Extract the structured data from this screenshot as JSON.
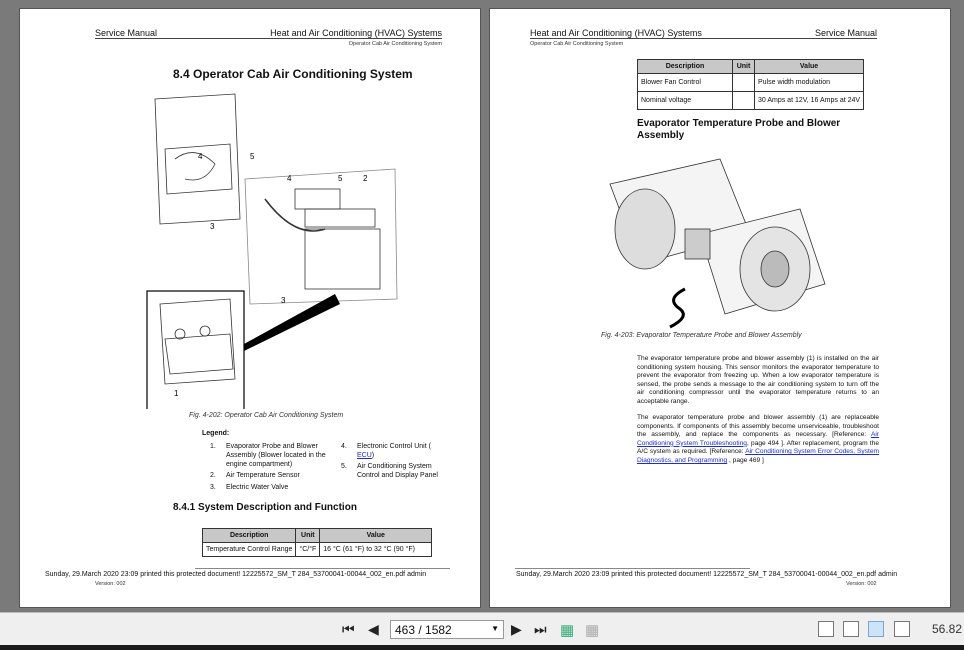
{
  "left_page": {
    "header_left": "Service Manual",
    "header_right": "Heat and Air Conditioning (HVAC) Systems",
    "header_sub": "Operator Cab Air Conditioning System",
    "title": "8.4  Operator Cab Air Conditioning System",
    "figure_callouts": [
      "4",
      "5",
      "3",
      "4",
      "5",
      "2",
      "3",
      "1"
    ],
    "figure_caption": "Fig.  4-202: Operator Cab Air Conditioning System",
    "legend_title": "Legend:",
    "legend": [
      {
        "n": "1.",
        "text": "Evaporator Probe and Blower Assembly (Blower located in the engine compartment)"
      },
      {
        "n": "2.",
        "text": "Air Temperature Sensor"
      },
      {
        "n": "3.",
        "text": "Electric Water Valve"
      },
      {
        "n": "4.",
        "text": "Electronic Control Unit (",
        "link": "ECU",
        "after": ")"
      },
      {
        "n": "5.",
        "text": "Air Conditioning System Control and Display Panel"
      }
    ],
    "section": "8.4.1  System Description and Function",
    "table": {
      "headers": [
        "Description",
        "Unit",
        "Value"
      ],
      "rows": [
        [
          "Temperature Control Range",
          "°C/°F",
          "16 °C (61 °F) to 32 °C (90 °F)"
        ]
      ]
    },
    "footer": "Sunday, 29.March 2020 23:09 printed this protected document! 12225572_SM_T 284_53700041-00044_002_en.pdf admin",
    "version": "Version: 002"
  },
  "right_page": {
    "header_left": "Heat and Air Conditioning (HVAC) Systems",
    "header_right": "Service Manual",
    "header_sub": "Operator Cab Air Conditioning System",
    "table": {
      "headers": [
        "Description",
        "Unit",
        "Value"
      ],
      "rows": [
        [
          "Blower Fan Control",
          "",
          "Pulse width modulation"
        ],
        [
          "Nominal voltage",
          "",
          "30 Amps at 12V, 16 Amps at 24V"
        ]
      ]
    },
    "heading": "Evaporator Temperature Probe and Blower Assembly",
    "figure_caption": "Fig.  4-203: Evaporator Temperature Probe and Blower Assembly",
    "para1": "The evaporator temperature probe and blower assembly (1) is installed on the air conditioning system housing. This sensor monitors the evaporator temperature to prevent the evaporator from freezing up. When a low evaporator temperature is sensed, the probe sends a message to the air conditioning system to turn off the air conditioning compressor until the evaporator temperature returns to an acceptable range.",
    "para2_a": "The evaporator temperature probe and blower assembly (1) are replaceable components. If components of this assembly become unserviceable, troubleshoot the assembly, and replace the components as necessary. [Reference: ",
    "para2_link1": "Air Conditioning System Troubleshooting",
    "para2_b": ", page   494 ]. After replacement, program the A/C system as required. [Reference: ",
    "para2_link2": "Air Conditioning System Error Codes, System Diagnostics, and Programming",
    "para2_c": " , page   469 ]",
    "footer": "Sunday, 29.March 2020 23:09 printed this protected document! 12225572_SM_T 284_53700041-00044_002_en.pdf admin",
    "version": "Version: 002"
  },
  "toolbar": {
    "page_value": "463 / 1582",
    "zoom": "56.82",
    "icons": [
      "first-page-icon",
      "prev-page-icon",
      "next-page-icon",
      "last-page-icon",
      "go-back-view-icon",
      "go-forward-view-icon",
      "single-page-view-icon",
      "continuous-view-icon",
      "facing-view-icon",
      "continuous-facing-view-icon"
    ]
  }
}
